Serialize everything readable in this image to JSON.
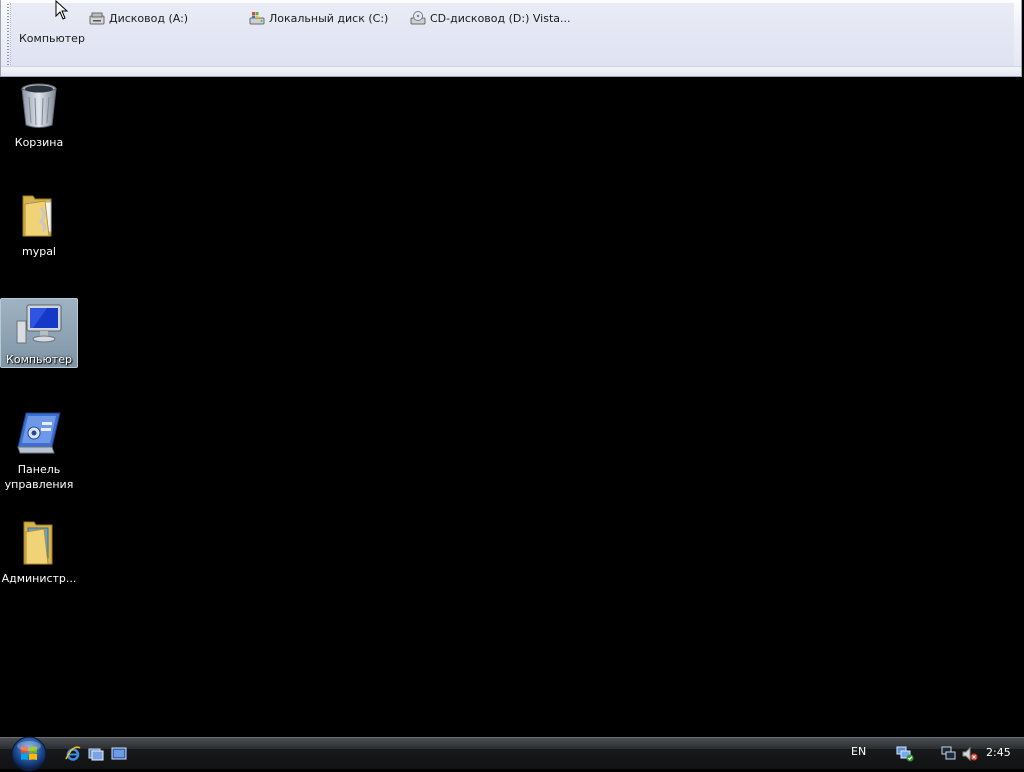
{
  "toolbar": {
    "label": "Компьютер",
    "drives": [
      {
        "label": "Дисковод (A:)",
        "icon": "floppy-drive-icon"
      },
      {
        "label": "Локальный диск (C:)",
        "icon": "local-disk-icon"
      },
      {
        "label": "CD-дисковод (D:) Vista...",
        "icon": "cd-drive-icon"
      }
    ]
  },
  "desktop": {
    "icons": [
      {
        "label": "Корзина",
        "icon": "recycle-bin-icon"
      },
      {
        "label": "mypal",
        "icon": "folder-icon"
      },
      {
        "label": "Компьютер",
        "icon": "computer-icon",
        "selected": true
      },
      {
        "label": "Панель управления",
        "icon": "control-panel-icon"
      },
      {
        "label": "Администр...",
        "icon": "admin-tools-folder-icon"
      }
    ]
  },
  "taskbar": {
    "quick_launch": [
      "ie-icon",
      "switch-windows-icon",
      "show-desktop-icon"
    ],
    "language": "EN",
    "tray": [
      "network-status-icon",
      "network-icon",
      "volume-muted-icon"
    ],
    "clock": "2:45"
  },
  "colors": {
    "desktop_bg": "#000000",
    "toolbar_bg": "#e6e8f4",
    "selection": "#8fa4b4",
    "taskbar": "#1b1c1f"
  }
}
